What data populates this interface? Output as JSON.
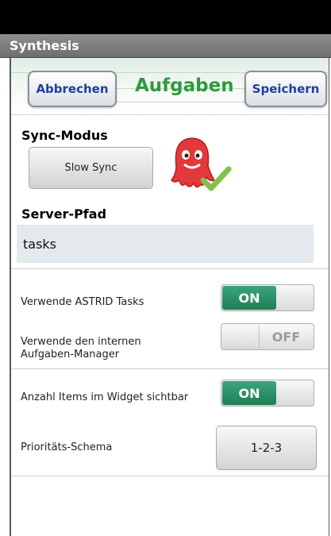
{
  "app": {
    "title": "Synthesis"
  },
  "header": {
    "cancel_label": "Abbrechen",
    "title": "Aufgaben",
    "save_label": "Speichern",
    "title_color": "#2f9a3e"
  },
  "sync": {
    "label": "Sync-Modus",
    "button_label": "Slow Sync"
  },
  "server_path": {
    "label": "Server-Pfad",
    "value": "tasks"
  },
  "settings": [
    {
      "label": "Verwende ASTRID Tasks",
      "state": "ON"
    },
    {
      "label": "Verwende den internen\nAufgaben-Manager",
      "state": "OFF"
    },
    {
      "label": "Anzahl Items im Widget sichtbar",
      "state": "ON"
    }
  ],
  "priority": {
    "label": "Prioritäts-Schema",
    "value": "1-2-3"
  },
  "icons": {
    "mascot": "octopus-mascot-icon",
    "check": "check-icon"
  },
  "colors": {
    "toggle_on": "#2a936a",
    "accent_text": "#1c3fa3"
  }
}
